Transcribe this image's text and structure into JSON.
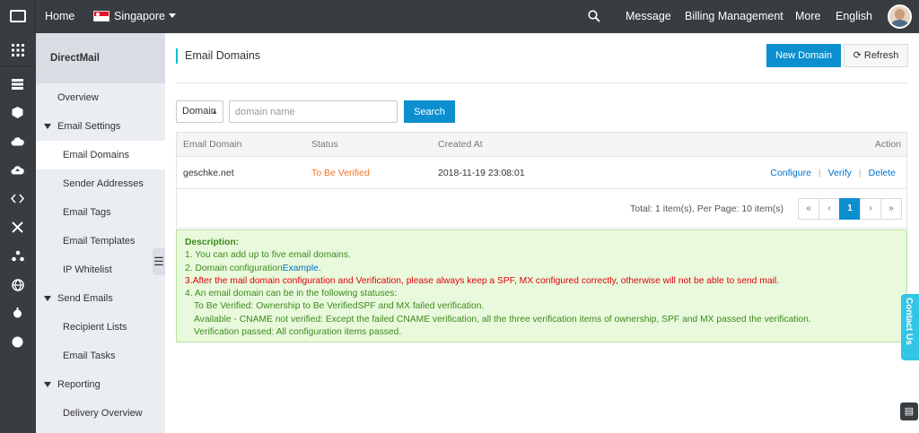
{
  "topbar": {
    "home": "Home",
    "region": "Singapore",
    "message": "Message",
    "billing": "Billing Management",
    "more": "More",
    "language": "English"
  },
  "rail_icons": [
    "grid-icon",
    "server-icon",
    "cube-icon",
    "cloud-icon",
    "cloud-upload-icon",
    "code-icon",
    "network-icon",
    "share-icon",
    "globe-icon",
    "gear-icon",
    "circle-icon"
  ],
  "sidebar": {
    "title": "DirectMail",
    "items": [
      {
        "label": "Overview"
      },
      {
        "label": "Email Settings"
      },
      {
        "label": "Email Domains"
      },
      {
        "label": "Sender Addresses"
      },
      {
        "label": "Email Tags"
      },
      {
        "label": "Email Templates"
      },
      {
        "label": "IP Whitelist"
      },
      {
        "label": "Send Emails"
      },
      {
        "label": "Recipient Lists"
      },
      {
        "label": "Email Tasks"
      },
      {
        "label": "Reporting"
      },
      {
        "label": "Delivery Overview"
      }
    ]
  },
  "main": {
    "title": "Email Domains",
    "new_domain": "New Domain",
    "refresh": "Refresh",
    "filter_select": "Domain",
    "search_placeholder": "domain name",
    "search_button": "Search",
    "table": {
      "headers": [
        "Email Domain",
        "Status",
        "Created At",
        "Action"
      ],
      "rows": [
        {
          "domain": "geschke.net",
          "status": "To Be Verified",
          "created_at": "2018-11-19 23:08:01",
          "actions": [
            "Configure",
            "Verify",
            "Delete"
          ]
        }
      ],
      "total": "Total: 1 item(s), Per Page: 10 item(s)",
      "pager": [
        "«",
        "‹",
        "1",
        "›",
        "»"
      ]
    },
    "description": {
      "heading": "Description:",
      "line1": "1. You can add up to five email domains.",
      "line2_prefix": "2. Domain configuration",
      "line2_link": "Example.",
      "line3": "3.After the mail domain configuration and Verification,   please always keep a SPF, MX configured correctly, otherwise will not be able to send mail.",
      "line4": "4. An email domain can be in the following statuses:",
      "line5": "To Be Verified: Ownership to Be VerifiedSPF and MX failed verification.",
      "line6": "Available - CNAME not verified: Except the failed CNAME verification, all the three verification items of ownership, SPF and MX passed the verification.",
      "line7": "Verification passed: All configuration items passed."
    }
  },
  "contact_us": "Contact Us",
  "colors": {
    "topbar": "#373d41",
    "primary": "#0c8fcf",
    "status_pending": "#f37327",
    "desc_green": "#3d8a1e",
    "desc_red": "#e0000b"
  }
}
